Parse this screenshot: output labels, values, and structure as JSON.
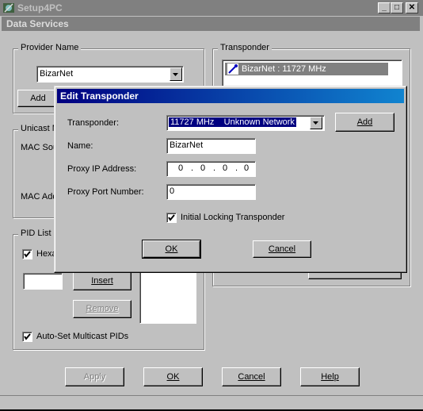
{
  "window": {
    "title": "Setup4PC",
    "subtitle": "Data Services",
    "minimize_label": "_",
    "maximize_label": "□",
    "close_label": "✕"
  },
  "provider": {
    "group_label": "Provider Name",
    "selected": "BizarNet",
    "add_button": "Add"
  },
  "transponder_group": {
    "group_label": "Transponder",
    "items": [
      "BizarNet : 11727 MHz"
    ]
  },
  "unicast": {
    "group_label": "Unicast M",
    "mac_source_label": "MAC Sou",
    "mac_address_label": "MAC Add"
  },
  "pid_list": {
    "group_label": "PID List",
    "hex_label": "Hexa",
    "insert_button": "Insert",
    "remove_button": "Remove",
    "auto_set_label": "Auto-Set Multicast PIDs"
  },
  "footer": {
    "apply": "Apply",
    "ok": "OK",
    "cancel": "Cancel",
    "help": "Help"
  },
  "dialog": {
    "title": "Edit Transponder",
    "transponder_label": "Transponder:",
    "transponder_value": "11727 MHz    Unknown Network",
    "add_button": "Add",
    "name_label": "Name:",
    "name_value": "BizarNet",
    "proxy_ip_label": "Proxy IP Address:",
    "proxy_ip_octets": [
      "0",
      "0",
      "0",
      "0"
    ],
    "proxy_port_label": "Proxy Port Number:",
    "proxy_port_value": "0",
    "initial_locking_label": "Initial Locking Transponder",
    "initial_locking_checked": true,
    "ok_button": "OK",
    "cancel_button": "Cancel"
  },
  "colors": {
    "face": "#c0c0c0",
    "active_title": "#000080",
    "inactive_title": "#808080",
    "selection": "#000080"
  }
}
